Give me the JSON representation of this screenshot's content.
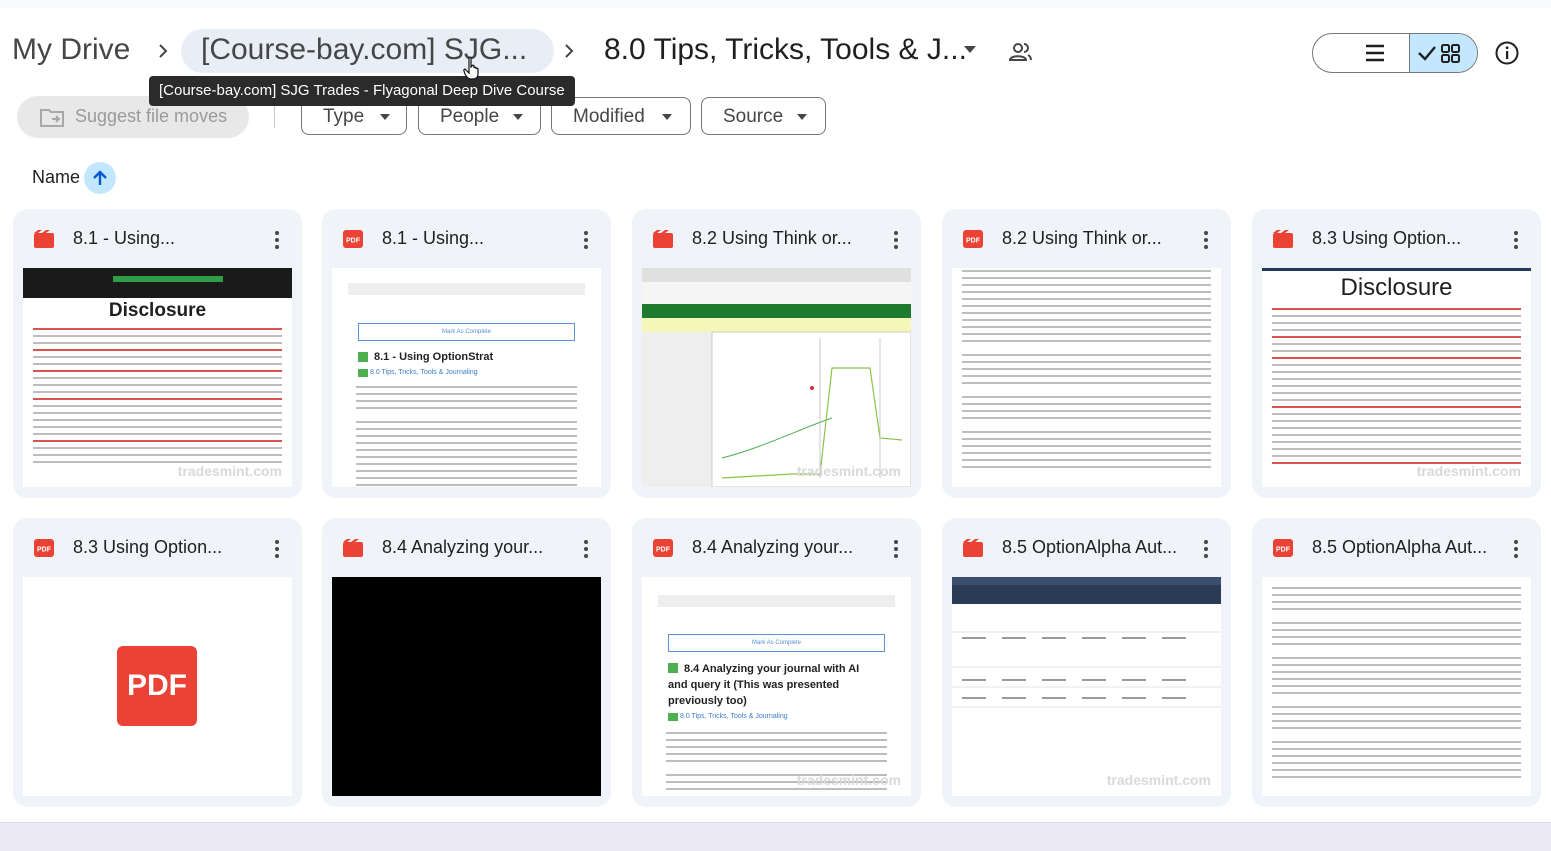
{
  "breadcrumb": {
    "root": "My Drive",
    "middle": "[Course-bay.com] SJG...",
    "current": "8.0 Tips, Tricks, Tools & J..."
  },
  "tooltip": "[Course-bay.com] SJG Trades - Flyagonal Deep Dive Course",
  "toolbar": {
    "suggest_label": "Suggest file moves",
    "filters": [
      "Type",
      "People",
      "Modified",
      "Source"
    ]
  },
  "sort": {
    "label": "Name",
    "direction": "ascending"
  },
  "files": [
    {
      "title": "8.1 - Using...",
      "kind": "video",
      "preview": "Disclosure"
    },
    {
      "title": "8.1 - Using...",
      "kind": "pdf",
      "preview": "8.1 - Using OptionStrat",
      "preview_sub": "8.0 Tips, Tricks, Tools & Journaling",
      "preview_button": "Mark As Complete"
    },
    {
      "title": "8.2 Using Think or...",
      "kind": "video",
      "preview": ""
    },
    {
      "title": "8.2 Using Think or...",
      "kind": "pdf",
      "preview": ""
    },
    {
      "title": "8.3 Using Option...",
      "kind": "video",
      "preview": "Disclosure"
    },
    {
      "title": "8.3 Using Option...",
      "kind": "pdf",
      "preview": "PDF"
    },
    {
      "title": "8.4 Analyzing your...",
      "kind": "video",
      "preview": ""
    },
    {
      "title": "8.4 Analyzing your...",
      "kind": "pdf",
      "preview": "8.4 Analyzing your journal with AI and query it (This was presented previously too)",
      "preview_sub": "8.0 Tips, Tricks, Tools & Journaling",
      "preview_button": "Mark As Complete"
    },
    {
      "title": "8.5 OptionAlpha Aut...",
      "kind": "video",
      "preview": ""
    },
    {
      "title": "8.5 OptionAlpha Aut...",
      "kind": "pdf",
      "preview": ""
    }
  ],
  "watermark": "tradesmint.com",
  "colors": {
    "video_icon": "#ea4335",
    "pdf_icon": "#ea4335",
    "selected": "#c2e7ff",
    "card_bg": "#f0f4f9"
  }
}
